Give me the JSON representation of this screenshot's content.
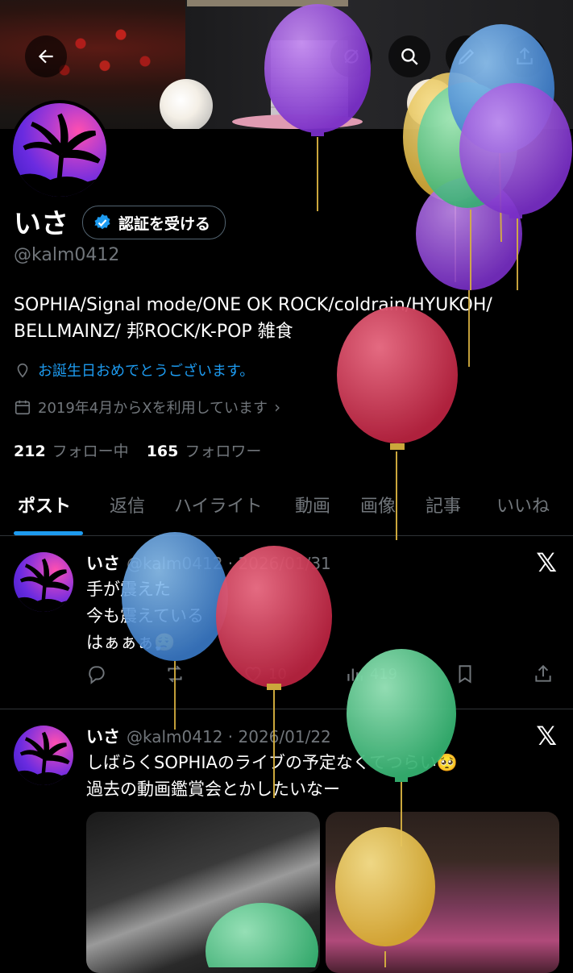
{
  "header": {
    "back_icon": "arrow-left-icon",
    "search_icon": "search-icon",
    "share_icon": "share-icon"
  },
  "profile": {
    "name": "いさ",
    "verify_label": "認証を受ける",
    "handle": "@kalm0412",
    "bio_line1": "SOPHIA/Signal mode/ONE OK ROCK/coldrain/HYUKOH/",
    "bio_line2": "BELLMAINZ/ 邦ROCK/K-POP 雑食",
    "location": "お誕生日おめでとうございます。",
    "joined": "2019年4月からXを利用しています",
    "following_count": "212",
    "following_label": "フォロー中",
    "followers_count": "165",
    "followers_label": "フォロワー"
  },
  "tabs": [
    "ポスト",
    "返信",
    "ハイライト",
    "動画",
    "画像",
    "記事",
    "いいね"
  ],
  "posts": [
    {
      "name": "いさ",
      "meta": "@kalm0412 · 2026/01/31",
      "text": "手が震えた\n今も震えている\nはぁぁぁ😮‍💨",
      "likes": "10",
      "views": "419"
    },
    {
      "name": "いさ",
      "meta": "@kalm0412 · 2026/01/22",
      "text": "しばらくSOPHIAのライブの予定なくてつらい🥺\n過去の動画鑑賞会とかしたいなー"
    }
  ],
  "colors": {
    "accent": "#1d9bf0",
    "balloon_purple": "#8a3fd4",
    "balloon_red": "#c8334a",
    "balloon_blue": "#4a90d9",
    "balloon_green": "#4fc98a",
    "balloon_yellow": "#e8c040"
  }
}
